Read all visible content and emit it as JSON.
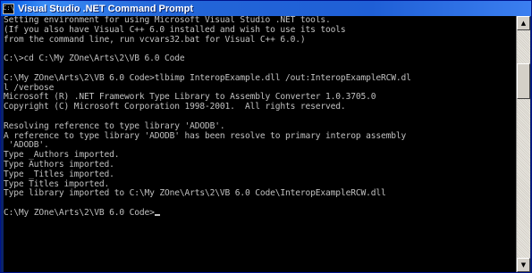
{
  "window": {
    "title": "Visual Studio .NET Command Prompt",
    "icon_label": "C:\\",
    "icon_name": "console-window-icon"
  },
  "console": {
    "lines": [
      "Setting environment for using Microsoft Visual Studio .NET tools.",
      "(If you also have Visual C++ 6.0 installed and wish to use its tools",
      "from the command line, run vcvars32.bat for Visual C++ 6.0.)",
      "",
      "C:\\>cd C:\\My ZOne\\Arts\\2\\VB 6.0 Code",
      "",
      "C:\\My ZOne\\Arts\\2\\VB 6.0 Code>tlbimp InteropExample.dll /out:InteropExampleRCW.dl",
      "l /verbose",
      "Microsoft (R) .NET Framework Type Library to Assembly Converter 1.0.3705.0",
      "Copyright (C) Microsoft Corporation 1998-2001.  All rights reserved.",
      "",
      "Resolving reference to type library 'ADODB'.",
      "A reference to type library 'ADODB' has been resolve to primary interop assembly",
      " 'ADODB'.",
      "Type _Authors imported.",
      "Type Authors imported.",
      "Type _Titles imported.",
      "Type Titles imported.",
      "Type library imported to C:\\My ZOne\\Arts\\2\\VB 6.0 Code\\InteropExampleRCW.dll",
      "",
      "C:\\My ZOne\\Arts\\2\\VB 6.0 Code>"
    ],
    "colors": {
      "background": "#000000",
      "foreground": "#c0c0c0"
    }
  },
  "scrollbar": {
    "up_icon": "scroll-up-arrow-icon",
    "down_icon": "scroll-down-arrow-icon",
    "scroll_position_fraction": 0.17
  },
  "colors": {
    "titlebar": "#1f5fd6",
    "title_text": "#ffffff"
  }
}
